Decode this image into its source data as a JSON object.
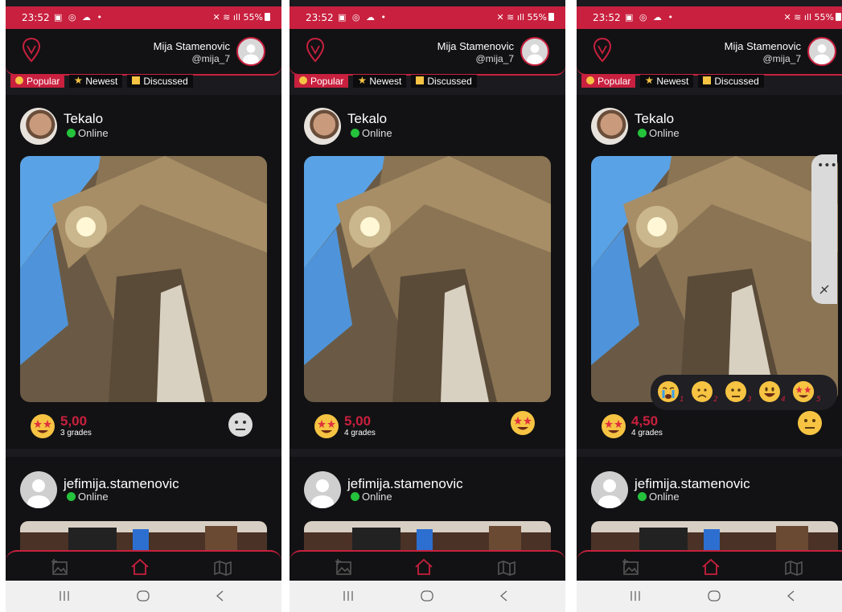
{
  "colors": {
    "accent": "#c8203e",
    "online": "#25c23c",
    "background": "#1b1b1f",
    "card": "#121214"
  },
  "status_bar": {
    "time": "23:52",
    "battery": "55%"
  },
  "header": {
    "user_name": "Mija Stamenovic",
    "user_handle": "@mija_7"
  },
  "tabs": [
    {
      "label": "Popular",
      "icon": "smile-icon"
    },
    {
      "label": "Newest",
      "icon": "star-icon"
    },
    {
      "label": "Discussed",
      "icon": "chat-icon"
    }
  ],
  "posts": [
    {
      "user": "Tekalo",
      "status": "Online"
    },
    {
      "user": "jefimija.stamenovic",
      "status": "Online"
    }
  ],
  "screens": [
    {
      "rating_value": "5,00",
      "rating_count": "3 grades",
      "my_reaction": "neutral-face-icon"
    },
    {
      "rating_value": "5,00",
      "rating_count": "4 grades",
      "my_reaction": "star-struck-icon"
    },
    {
      "rating_value": "4,50",
      "rating_count": "4 grades",
      "my_reaction": "neutral-face-icon"
    }
  ],
  "reaction_picker": {
    "options": [
      {
        "icon": "crying-face-icon",
        "number": "1"
      },
      {
        "icon": "worried-face-icon",
        "number": "2"
      },
      {
        "icon": "neutral-face-icon",
        "number": "3"
      },
      {
        "icon": "smiling-face-icon",
        "number": "4"
      },
      {
        "icon": "star-struck-icon",
        "number": "5"
      }
    ]
  },
  "bottom_nav": [
    "add-photo-icon",
    "home-icon",
    "map-icon"
  ]
}
